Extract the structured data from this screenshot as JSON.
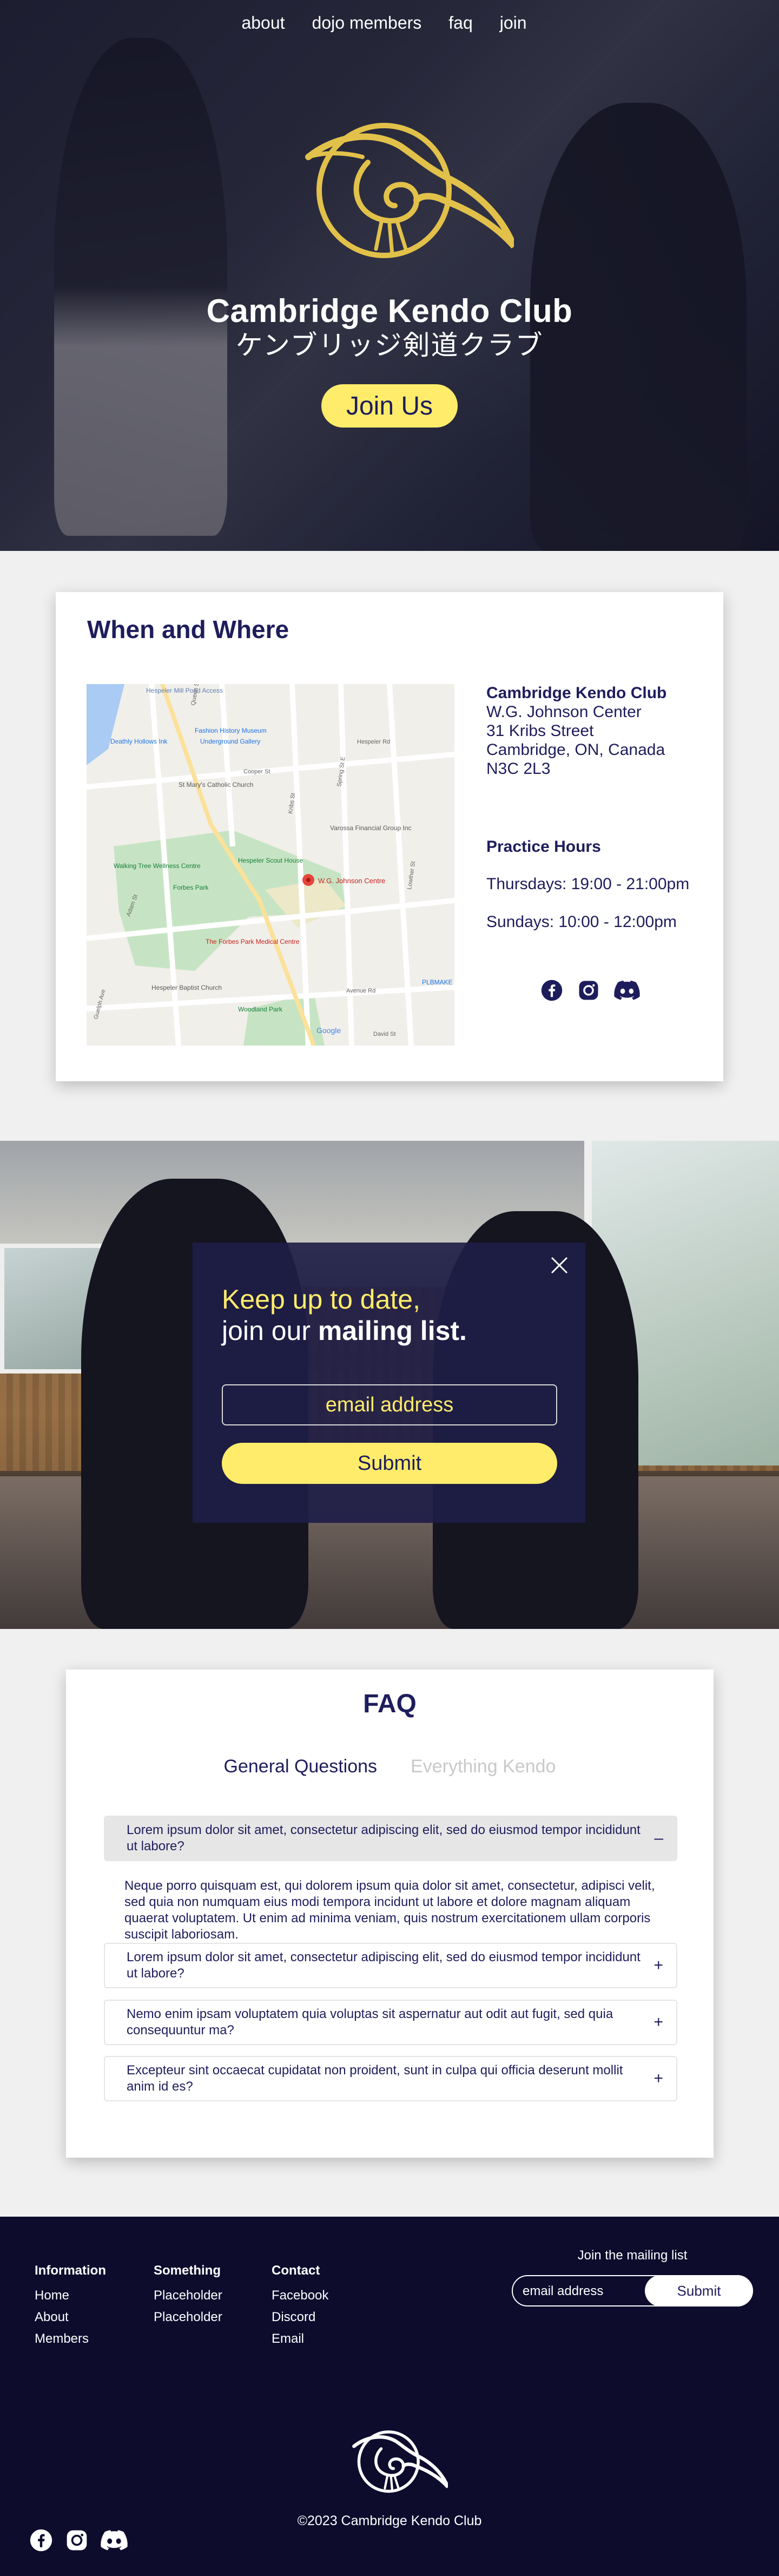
{
  "nav": {
    "items": [
      "about",
      "dojo members",
      "faq",
      "join"
    ]
  },
  "hero": {
    "title": "Cambridge Kendo Club",
    "subtitle": "ケンブリッジ剣道クラブ",
    "join_label": "Join Us"
  },
  "location": {
    "heading": "When and Where",
    "club_name": "Cambridge Kendo Club",
    "address": [
      "W.G. Johnson Center",
      "31 Kribs Street",
      "Cambridge, ON, Canada",
      "N3C 2L3"
    ],
    "hours_heading": "Practice Hours",
    "hours": [
      "Thursdays: 19:00 - 21:00pm",
      "Sundays: 10:00 - 12:00pm"
    ],
    "map": {
      "marker_label": "W.G. Johnson Centre",
      "places": [
        "Hespeler Mill Pond Access",
        "Fashion History Museum",
        "Underground Gallery",
        "Deathly Hollows Ink",
        "St Mary's Catholic Church",
        "Varossa Financial Group Inc",
        "Hespeler Scout House",
        "Walking Tree Wellness Centre",
        "Forbes Park",
        "The Forbes Park Medical Centre",
        "Hespeler Baptist Church",
        "Woodland Park",
        "PLBMAKE",
        "Google"
      ],
      "streets": [
        "Queen St E",
        "Cooper St",
        "Kribs St",
        "Adam St",
        "Guelph Ave",
        "Spring St E",
        "Avenue Rd",
        "David St",
        "Hespeler Rd",
        "Lowther St"
      ]
    },
    "social_icons": [
      "facebook-icon",
      "instagram-icon",
      "discord-icon"
    ]
  },
  "subscribe": {
    "line1": "Keep up to date,",
    "line2_prefix": "join our ",
    "line2_bold": "mailing list.",
    "email_placeholder": "email address",
    "submit_label": "Submit",
    "close_icon": "close-icon"
  },
  "faq": {
    "heading": "FAQ",
    "tabs": [
      "General Questions",
      "Everything Kendo"
    ],
    "active_tab": "General Questions",
    "questions": [
      {
        "q": "Lorem ipsum dolor sit amet, consectetur adipiscing elit, sed do eiusmod tempor incididunt ut labore?",
        "open": true,
        "toggle": "–"
      },
      {
        "q": "Lorem ipsum dolor sit amet, consectetur adipiscing elit, sed do eiusmod tempor incididunt ut labore?",
        "open": false,
        "toggle": "+"
      },
      {
        "q": "Nemo enim ipsam voluptatem quia voluptas sit aspernatur aut odit aut fugit, sed quia consequuntur ma?",
        "open": false,
        "toggle": "+"
      },
      {
        "q": "Excepteur sint occaecat cupidatat non proident, sunt in culpa qui officia deserunt mollit anim id es?",
        "open": false,
        "toggle": "+"
      }
    ],
    "answer": "Neque porro quisquam est, qui dolorem ipsum quia dolor sit amet, consectetur, adipisci velit, sed quia non numquam eius modi tempora incidunt ut labore et dolore magnam aliquam quaerat voluptatem. Ut enim ad minima veniam, quis nostrum exercitationem ullam corporis suscipit laboriosam."
  },
  "footer": {
    "columns": [
      {
        "heading": "Information",
        "links": [
          "Home",
          "About",
          "Members"
        ]
      },
      {
        "heading": "Something",
        "links": [
          "Placeholder",
          "Placeholder"
        ]
      },
      {
        "heading": "Contact",
        "links": [
          "Facebook",
          "Discord",
          "Email"
        ]
      }
    ],
    "mailing_title": "Join the mailing list",
    "email_placeholder": "email address",
    "submit_label": "Submit",
    "copyright": "©2023 Cambridge Kendo Club",
    "social_icons": [
      "facebook-icon",
      "instagram-icon",
      "discord-icon"
    ]
  },
  "colors": {
    "navy": "#1e1d5c",
    "yellow": "#ffec6b",
    "gold": "#e2c14a",
    "footer": "#0d0c2d",
    "background": "#f0f0f0"
  }
}
